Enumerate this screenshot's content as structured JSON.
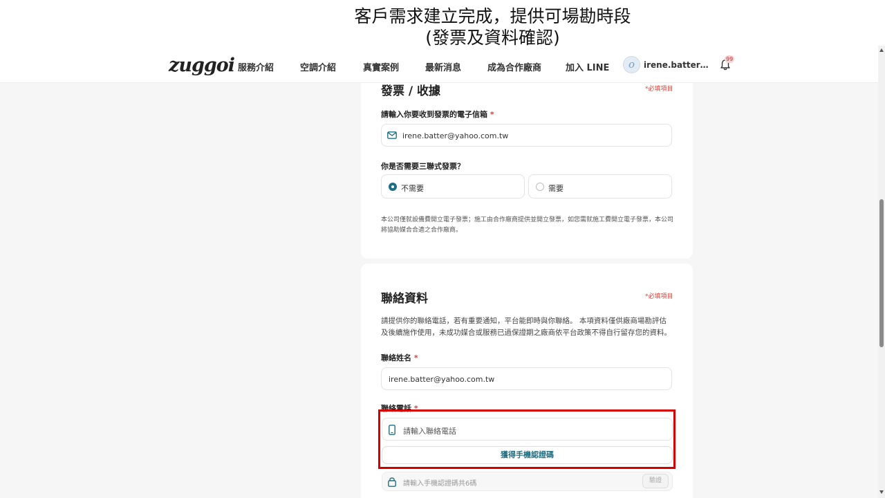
{
  "caption": {
    "line1": "客戶需求建立完成，提供可場勘時段",
    "line2": "(發票及資料確認)"
  },
  "navbar": {
    "logo": "zuggoi",
    "items": [
      "服務介紹",
      "空調介紹",
      "真實案例",
      "最新消息",
      "成為合作廠商",
      "加入 LINE"
    ],
    "user": "irene.batter@yah…",
    "avatar_letter": "o",
    "notification_count": "99"
  },
  "invoice": {
    "title": "發票 / 收據",
    "required_note": "*必填項目",
    "email_label": "請輸入你要收到發票的電子信箱",
    "email_value": "irene.batter@yahoo.com.tw",
    "triplicate_label": "你是否需要三聯式發票？",
    "options": [
      "不需要",
      "需要"
    ],
    "selected_option": "不需要",
    "note": "本公司僅就設備費開立電子發票；施工由合作廠商提供並開立發票，如您需就施工費開立電子發票，本公司將協助媒合合適之合作廠商。"
  },
  "contact": {
    "title": "聯絡資料",
    "required_note": "*必填項目",
    "description": "請提供你的聯絡電話，若有重要通知，平台能即時與你聯絡。 本項資料僅供廠商場勘評估及後續施作使用，未成功媒合或服務已過保證期之廠商依平台政策不得自行留存您的資料。",
    "name_label": "聯絡姓名",
    "name_value": "irene.batter@yahoo.com.tw",
    "phone_label": "聯絡電話",
    "phone_placeholder": "請輸入聯絡電話",
    "otp_button": "獲得手機認證碼",
    "code_placeholder": "請輸入手機認證碼共6碼",
    "verify_button": "驗證"
  },
  "colors": {
    "accent": "#1e6f83",
    "required": "#d9433a",
    "highlight": "#d40000"
  },
  "icons": [
    "email-icon",
    "phone-icon",
    "lock-icon",
    "bell-icon"
  ]
}
